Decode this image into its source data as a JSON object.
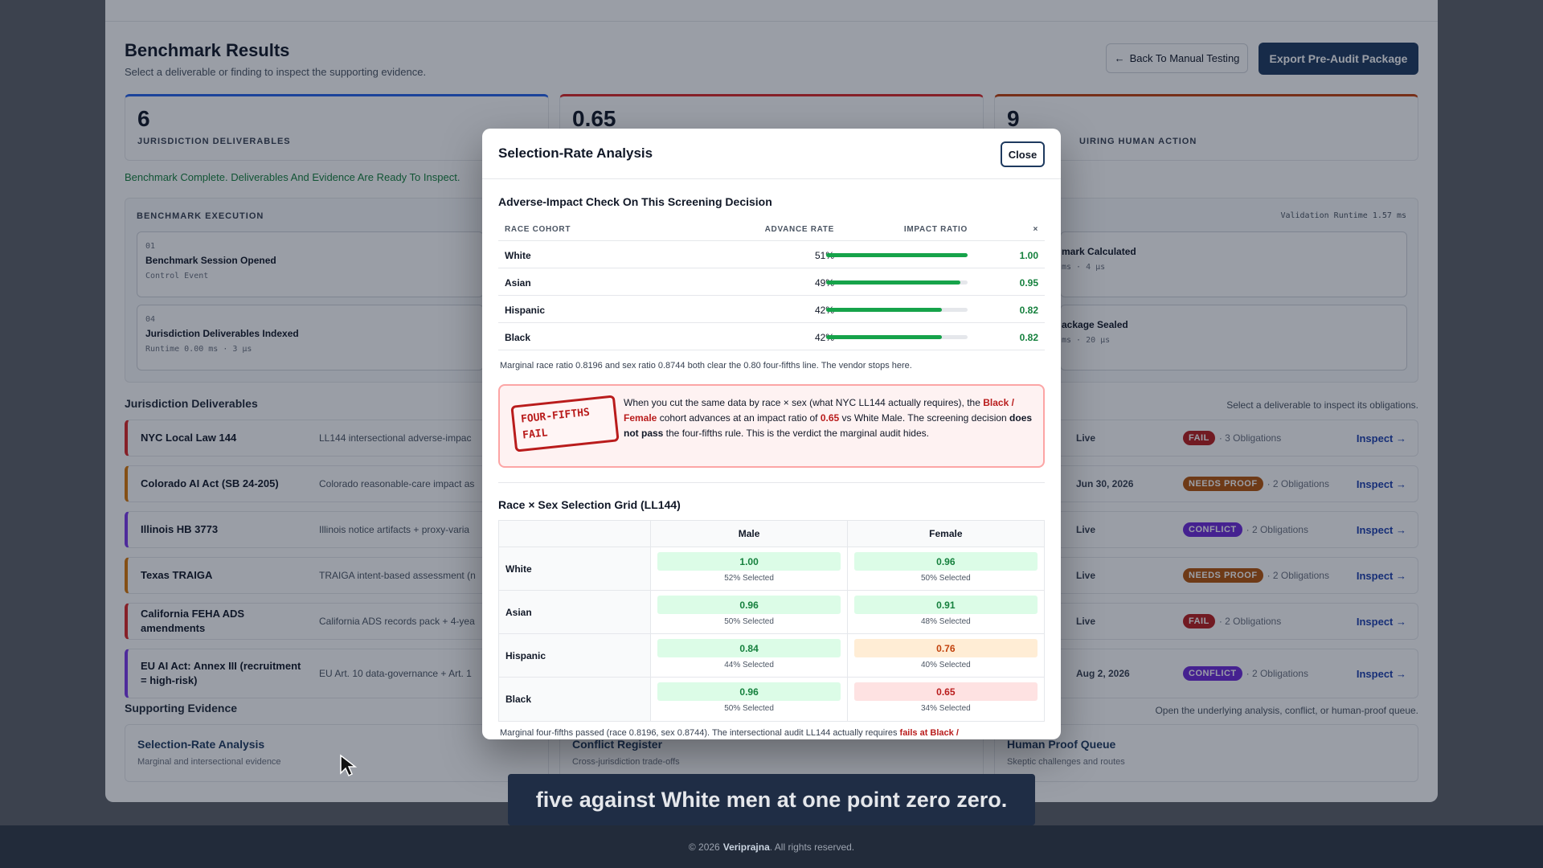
{
  "page": {
    "title": "Benchmark Results",
    "subtitle": "Select a deliverable or finding to inspect the supporting evidence.",
    "back_button": "Back To Manual Testing",
    "export_button": "Export Pre-Audit Package",
    "status_message": "Benchmark Complete. Deliverables And Evidence Are Ready To Inspect."
  },
  "stats": [
    {
      "value": "6",
      "label": "Jurisdiction Deliverables",
      "color": "#2563eb"
    },
    {
      "value": "0.65",
      "label": "",
      "color": "#dc2626"
    },
    {
      "value": "9",
      "label": "uiring Human Action",
      "color": "#c2410c"
    }
  ],
  "execution": {
    "title": "BENCHMARK EXECUTION",
    "runtime": "Validation Runtime 1.57 ms",
    "steps": [
      {
        "num": "01",
        "name": "Benchmark Session Opened",
        "meta": "Control Event"
      },
      {
        "num": "04",
        "name": "Jurisdiction Deliverables Indexed",
        "meta": "Runtime 0.00 ms · 3 µs"
      },
      {
        "num": "",
        "name": "mark Calculated",
        "meta": "ms · 4 µs"
      },
      {
        "num": "",
        "name": "ackage Sealed",
        "meta": "ms · 20 µs"
      }
    ]
  },
  "deliverables": {
    "title": "Jurisdiction Deliverables",
    "hint": "Select a deliverable to inspect its obligations.",
    "inspect_label": "Inspect →",
    "rows": [
      {
        "name": "NYC Local Law 144",
        "desc": "LL144 intersectional adverse-impac",
        "date": "Live",
        "status": "FAIL",
        "obligations": "· 3 Obligations",
        "color": "#dc2626",
        "pill": "#b91c1c"
      },
      {
        "name": "Colorado AI Act (SB 24-205)",
        "desc": "Colorado reasonable-care impact as",
        "date": "Jun 30, 2026",
        "status": "NEEDS PROOF",
        "obligations": "· 2 Obligations",
        "color": "#d97706",
        "pill": "#b45309"
      },
      {
        "name": "Illinois HB 3773",
        "desc": "Illinois notice artifacts + proxy-varia",
        "date": "Live",
        "status": "CONFLICT",
        "obligations": "· 2 Obligations",
        "color": "#7c3aed",
        "pill": "#6d28d9"
      },
      {
        "name": "Texas TRAIGA",
        "desc": "TRAIGA intent-based assessment (n",
        "date": "Live",
        "status": "NEEDS PROOF",
        "obligations": "· 2 Obligations",
        "color": "#d97706",
        "pill": "#b45309"
      },
      {
        "name": "California FEHA ADS amendments",
        "desc": "California ADS records pack + 4-yea",
        "date": "Live",
        "status": "FAIL",
        "obligations": "· 2 Obligations",
        "color": "#dc2626",
        "pill": "#b91c1c"
      },
      {
        "name": "EU AI Act: Annex III (recruitment = high-risk)",
        "desc": "EU Art. 10 data-governance + Art. 1",
        "date": "Aug 2, 2026",
        "status": "CONFLICT",
        "obligations": "· 2 Obligations",
        "color": "#7c3aed",
        "pill": "#6d28d9"
      }
    ]
  },
  "evidence": {
    "title": "Supporting Evidence",
    "hint": "Open the underlying analysis, conflict, or human-proof queue.",
    "cards": [
      {
        "name": "Selection-Rate Analysis",
        "desc": "Marginal and intersectional evidence"
      },
      {
        "name": "Conflict Register",
        "desc": "Cross-jurisdiction trade-offs"
      },
      {
        "name": "Human Proof Queue",
        "desc": "Skeptic challenges and routes"
      }
    ]
  },
  "footer": {
    "prefix": "© 2026",
    "brand": "Veriprajna",
    "suffix": ". All rights reserved."
  },
  "caption": "five against White men at one point zero zero.",
  "modal": {
    "title": "Selection-Rate Analysis",
    "close_label": "Close",
    "impact": {
      "title": "Adverse-Impact Check On This Screening Decision",
      "headers": {
        "cohort": "RACE COHORT",
        "rate": "ADVANCE RATE",
        "ratio": "IMPACT RATIO",
        "x": "×"
      },
      "rows": [
        {
          "cohort": "White",
          "rate": "51%",
          "ratio": "1.00",
          "fill": 1.0
        },
        {
          "cohort": "Asian",
          "rate": "49%",
          "ratio": "0.95",
          "fill": 0.95
        },
        {
          "cohort": "Hispanic",
          "rate": "42%",
          "ratio": "0.82",
          "fill": 0.82
        },
        {
          "cohort": "Black",
          "rate": "42%",
          "ratio": "0.82",
          "fill": 0.82
        }
      ],
      "note": "Marginal race ratio 0.8196 and sex ratio 0.8744 both clear the 0.80 four-fifths line. The vendor stops here."
    },
    "verdict": {
      "stamp_line1": "FOUR-FIFTHS",
      "stamp_line2": "FAIL",
      "t1": "When you cut the same data by race × sex (what NYC LL144 actually requires), the ",
      "cohort": "Black / Female",
      "t2": " cohort advances at an impact ratio of ",
      "ratio": "0.65",
      "t3": " vs White Male. The screening decision ",
      "bold": "does not pass",
      "t4": " the four-fifths rule. This is the verdict the marginal audit hides."
    },
    "grid": {
      "title": "Race × Sex Selection Grid (LL144)",
      "columns": [
        "Male",
        "Female"
      ],
      "rows": [
        {
          "race": "White",
          "cells": [
            {
              "ratio": "1.00",
              "selected": "52% Selected",
              "tone": "green"
            },
            {
              "ratio": "0.96",
              "selected": "50% Selected",
              "tone": "green"
            }
          ]
        },
        {
          "race": "Asian",
          "cells": [
            {
              "ratio": "0.96",
              "selected": "50% Selected",
              "tone": "green"
            },
            {
              "ratio": "0.91",
              "selected": "48% Selected",
              "tone": "green"
            }
          ]
        },
        {
          "race": "Hispanic",
          "cells": [
            {
              "ratio": "0.84",
              "selected": "44% Selected",
              "tone": "green"
            },
            {
              "ratio": "0.76",
              "selected": "40% Selected",
              "tone": "orange"
            }
          ]
        },
        {
          "race": "Black",
          "cells": [
            {
              "ratio": "0.96",
              "selected": "50% Selected",
              "tone": "green"
            },
            {
              "ratio": "0.65",
              "selected": "34% Selected",
              "tone": "red"
            }
          ]
        }
      ],
      "bottom_note": "Marginal four-fifths passed (race 0.8196, sex 0.8744). The intersectional audit LL144 actually requires ",
      "bottom_note_red": "fails at Black /"
    }
  }
}
